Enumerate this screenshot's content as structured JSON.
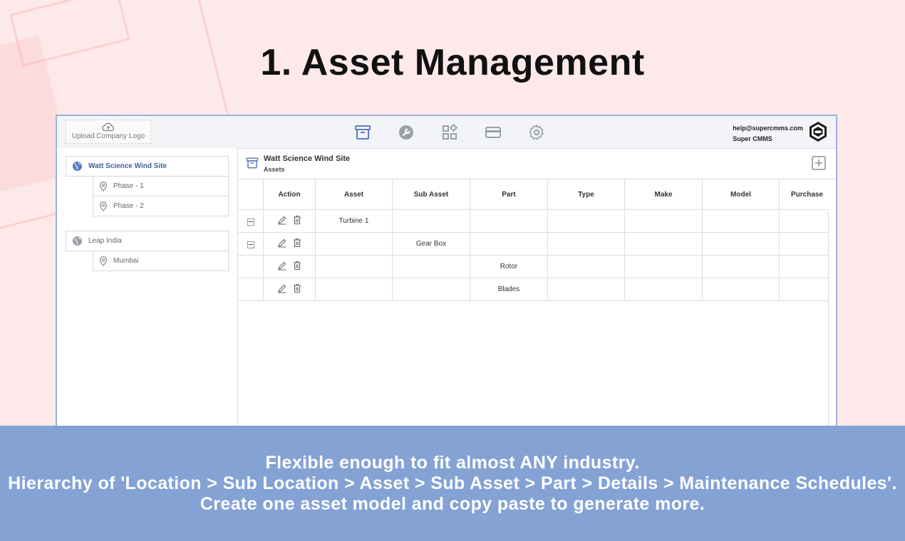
{
  "page": {
    "title": "1. Asset Management"
  },
  "header": {
    "upload_logo_label": "Upload Company Logo",
    "nav_icons": [
      "assets-icon",
      "wrench-icon",
      "modules-icon",
      "billing-icon",
      "settings-icon"
    ],
    "account_email": "help@supercmms.com",
    "account_name": "Super CMMS"
  },
  "sidebar": {
    "locations": [
      {
        "label": "Watt Science Wind Site",
        "active": true,
        "sub": [
          "Phase - 1",
          "Phase - 2"
        ]
      },
      {
        "label": "Leap India",
        "active": false,
        "sub": [
          "Mumbai"
        ]
      }
    ]
  },
  "content": {
    "title": "Watt Science Wind Site",
    "subtitle": "Assets",
    "table": {
      "columns": [
        "",
        "Action",
        "Asset",
        "Sub Asset",
        "Part",
        "Type",
        "Make",
        "Model",
        "Purchase"
      ],
      "rows": [
        {
          "collapsible": true,
          "asset": "Turbine 1",
          "sub_asset": "",
          "part": ""
        },
        {
          "collapsible": true,
          "asset": "",
          "sub_asset": "Gear Box",
          "part": ""
        },
        {
          "collapsible": false,
          "asset": "",
          "sub_asset": "",
          "part": "Rotor"
        },
        {
          "collapsible": false,
          "asset": "",
          "sub_asset": "",
          "part": "Blades"
        }
      ]
    }
  },
  "banner": {
    "line1": "Flexible enough to fit almost ANY industry.",
    "line2": "Hierarchy of 'Location > Sub Location > Asset > Sub Asset > Part > Details > Maintenance Schedules'.",
    "line3": "Create one asset model and copy paste to generate more."
  },
  "colors": {
    "accent": "#3f5fa3",
    "banner": "#84a2d4",
    "background": "#fde9ea",
    "icon_blue": "#5b7dc0"
  }
}
